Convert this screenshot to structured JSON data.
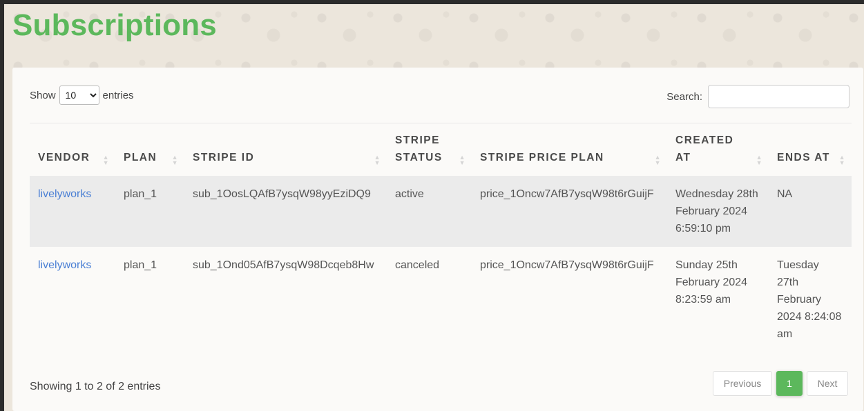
{
  "page": {
    "title": "Subscriptions"
  },
  "controls": {
    "show_label": "Show",
    "length_value": "10",
    "entries_label": "entries",
    "search_label": "Search:",
    "search_value": ""
  },
  "table": {
    "headers": {
      "vendor": "VENDOR",
      "plan": "PLAN",
      "stripe_id": "STRIPE ID",
      "stripe_status": "STRIPE STATUS",
      "stripe_price_plan": "STRIPE PRICE PLAN",
      "created_at": "CREATED AT",
      "ends_at": "ENDS AT"
    },
    "rows": [
      {
        "vendor": "livelyworks",
        "plan": "plan_1",
        "stripe_id": "sub_1OosLQAfB7ysqW98yyEziDQ9",
        "stripe_status": "active",
        "stripe_price_plan": "price_1Oncw7AfB7ysqW98t6rGuijF",
        "created_at": "Wednesday 28th February 2024 6:59:10 pm",
        "ends_at": "NA"
      },
      {
        "vendor": "livelyworks",
        "plan": "plan_1",
        "stripe_id": "sub_1Ond05AfB7ysqW98Dcqeb8Hw",
        "stripe_status": "canceled",
        "stripe_price_plan": "price_1Oncw7AfB7ysqW98t6rGuijF",
        "created_at": "Sunday 25th February 2024 8:23:59 am",
        "ends_at": "Tuesday 27th February 2024 8:24:08 am"
      }
    ]
  },
  "footer": {
    "info": "Showing 1 to 2 of 2 entries",
    "previous": "Previous",
    "current_page": "1",
    "next": "Next"
  },
  "colors": {
    "accent": "#5cb85c",
    "link": "#4a7fd4"
  }
}
